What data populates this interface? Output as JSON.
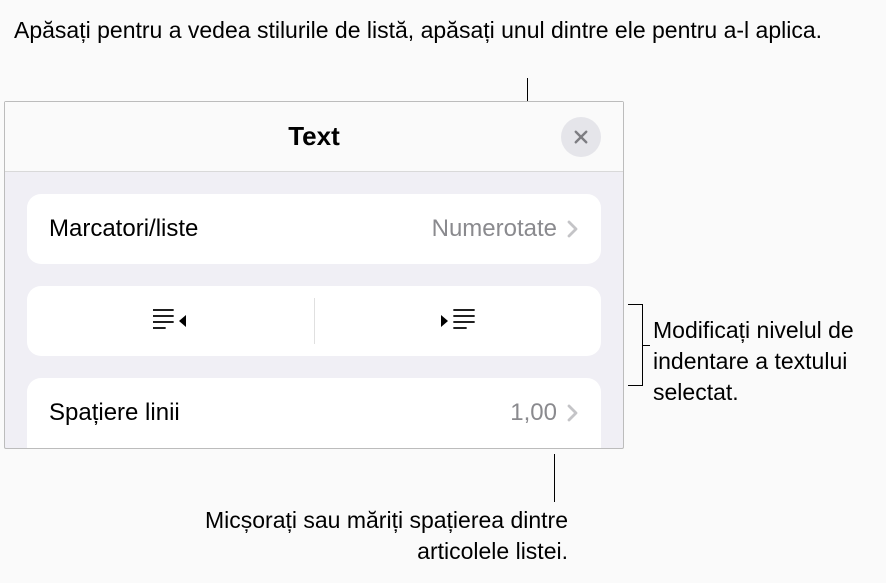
{
  "callouts": {
    "top": "Apăsați pentru a vedea stilurile de listă, apăsați unul dintre ele pentru a-l aplica.",
    "right": "Modificați nivelul de indentare a textului selectat.",
    "bottom": "Micșorați sau măriți spațierea dintre articolele listei."
  },
  "panel": {
    "title": "Text",
    "rows": {
      "bullets": {
        "label": "Marcatori/liste",
        "value": "Numerotate"
      },
      "lineSpacing": {
        "label": "Spațiere linii",
        "value": "1,00"
      }
    }
  }
}
